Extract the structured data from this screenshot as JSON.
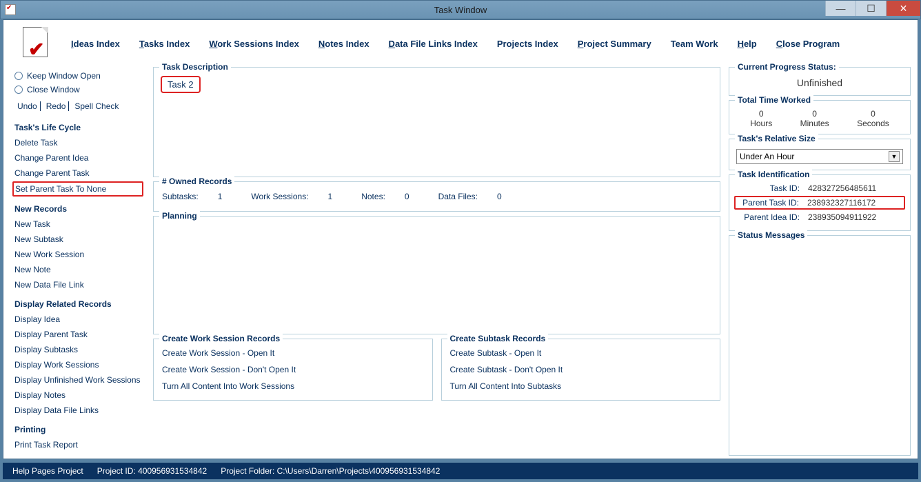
{
  "window": {
    "title": "Task Window"
  },
  "menu": {
    "ideas": "Ideas Index",
    "tasks": "Tasks Index",
    "work": "Work Sessions Index",
    "notes": "Notes Index",
    "data": "Data File Links Index",
    "projects": "Projects Index",
    "summary": "Project Summary",
    "team": "Team Work",
    "help": "Help",
    "close": "Close Program"
  },
  "sidebar": {
    "keep_open": "Keep Window Open",
    "close_window": "Close Window",
    "undo": "Undo",
    "redo": "Redo",
    "spell": "Spell Check",
    "lifecycle_h": "Task's Life Cycle",
    "delete_task": "Delete Task",
    "change_parent_idea": "Change Parent Idea",
    "change_parent_task": "Change Parent Task",
    "set_parent_none": "Set Parent Task To None",
    "new_records_h": "New Records",
    "new_task": "New Task",
    "new_subtask": "New Subtask",
    "new_work": "New Work Session",
    "new_note": "New Note",
    "new_data": "New Data File Link",
    "display_h": "Display Related Records",
    "display_idea": "Display Idea",
    "display_parent": "Display Parent Task",
    "display_subtasks": "Display Subtasks",
    "display_work": "Display Work Sessions",
    "display_unfinished": "Display Unfinished Work Sessions",
    "display_notes": "Display Notes",
    "display_data": "Display Data File Links",
    "printing_h": "Printing",
    "print_report": "Print Task Report"
  },
  "main": {
    "task_desc_legend": "Task Description",
    "task_desc_value": "Task 2",
    "owned_legend": "# Owned Records",
    "subtasks_label": "Subtasks:",
    "subtasks_val": "1",
    "work_label": "Work Sessions:",
    "work_val": "1",
    "notes_label": "Notes:",
    "notes_val": "0",
    "data_label": "Data Files:",
    "data_val": "0",
    "planning_legend": "Planning",
    "cws_legend": "Create Work Session Records",
    "cws_open": "Create Work Session - Open It",
    "cws_noopen": "Create Work Session - Don't Open It",
    "cws_turn": "Turn All Content Into Work Sessions",
    "csr_legend": "Create Subtask Records",
    "csr_open": "Create Subtask - Open It",
    "csr_noopen": "Create Subtask - Don't Open It",
    "csr_turn": "Turn All Content Into Subtasks"
  },
  "right": {
    "progress_legend": "Current Progress Status:",
    "progress_val": "Unfinished",
    "time_legend": "Total Time Worked",
    "hours_n": "0",
    "hours_l": "Hours",
    "minutes_n": "0",
    "minutes_l": "Minutes",
    "seconds_n": "0",
    "seconds_l": "Seconds",
    "relsize_legend": "Task's Relative Size",
    "relsize_val": "Under An Hour",
    "ident_legend": "Task Identification",
    "taskid_l": "Task ID:",
    "taskid_v": "428327256485611",
    "parenttask_l": "Parent Task ID:",
    "parenttask_v": "238932327116172",
    "parentidea_l": "Parent Idea ID:",
    "parentidea_v": "238935094911922",
    "statusmsg_legend": "Status Messages"
  },
  "footer": {
    "help_pages": "Help Pages Project",
    "project_id_l": "Project ID:",
    "project_id_v": "400956931534842",
    "project_folder_l": "Project Folder:",
    "project_folder_v": "C:\\Users\\Darren\\Projects\\400956931534842"
  }
}
